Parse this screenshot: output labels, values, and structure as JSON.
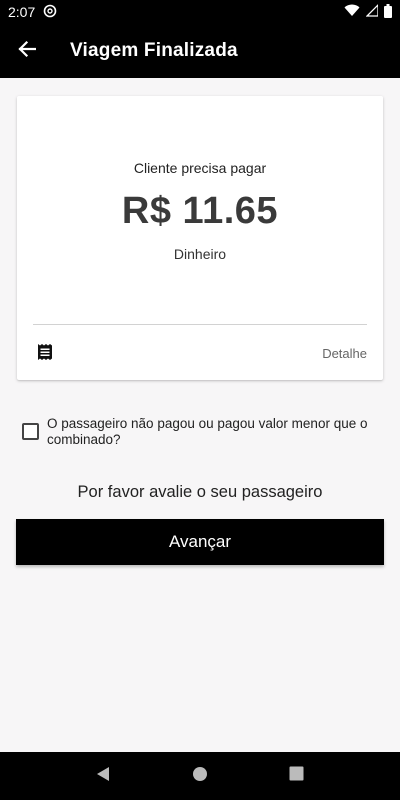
{
  "status_bar": {
    "time": "2:07"
  },
  "app_bar": {
    "title": "Viagem Finalizada"
  },
  "card": {
    "pay_label": "Cliente precisa pagar",
    "amount": "R$ 11.65",
    "method": "Dinheiro",
    "detail_label": "Detalhe"
  },
  "underpaid": {
    "label": "O passageiro não pagou ou pagou valor menor que o combinado?",
    "checked": false
  },
  "rate_prompt": "Por favor avalie o seu passageiro",
  "advance_button": "Avançar",
  "colors": {
    "primary": "#000000",
    "background": "#f7f6f7",
    "card": "#ffffff"
  },
  "icons": {
    "back": "arrow-left-icon",
    "receipt": "receipt-icon",
    "nav_back": "triangle-back-icon",
    "nav_home": "circle-home-icon",
    "nav_recents": "square-recents-icon"
  }
}
